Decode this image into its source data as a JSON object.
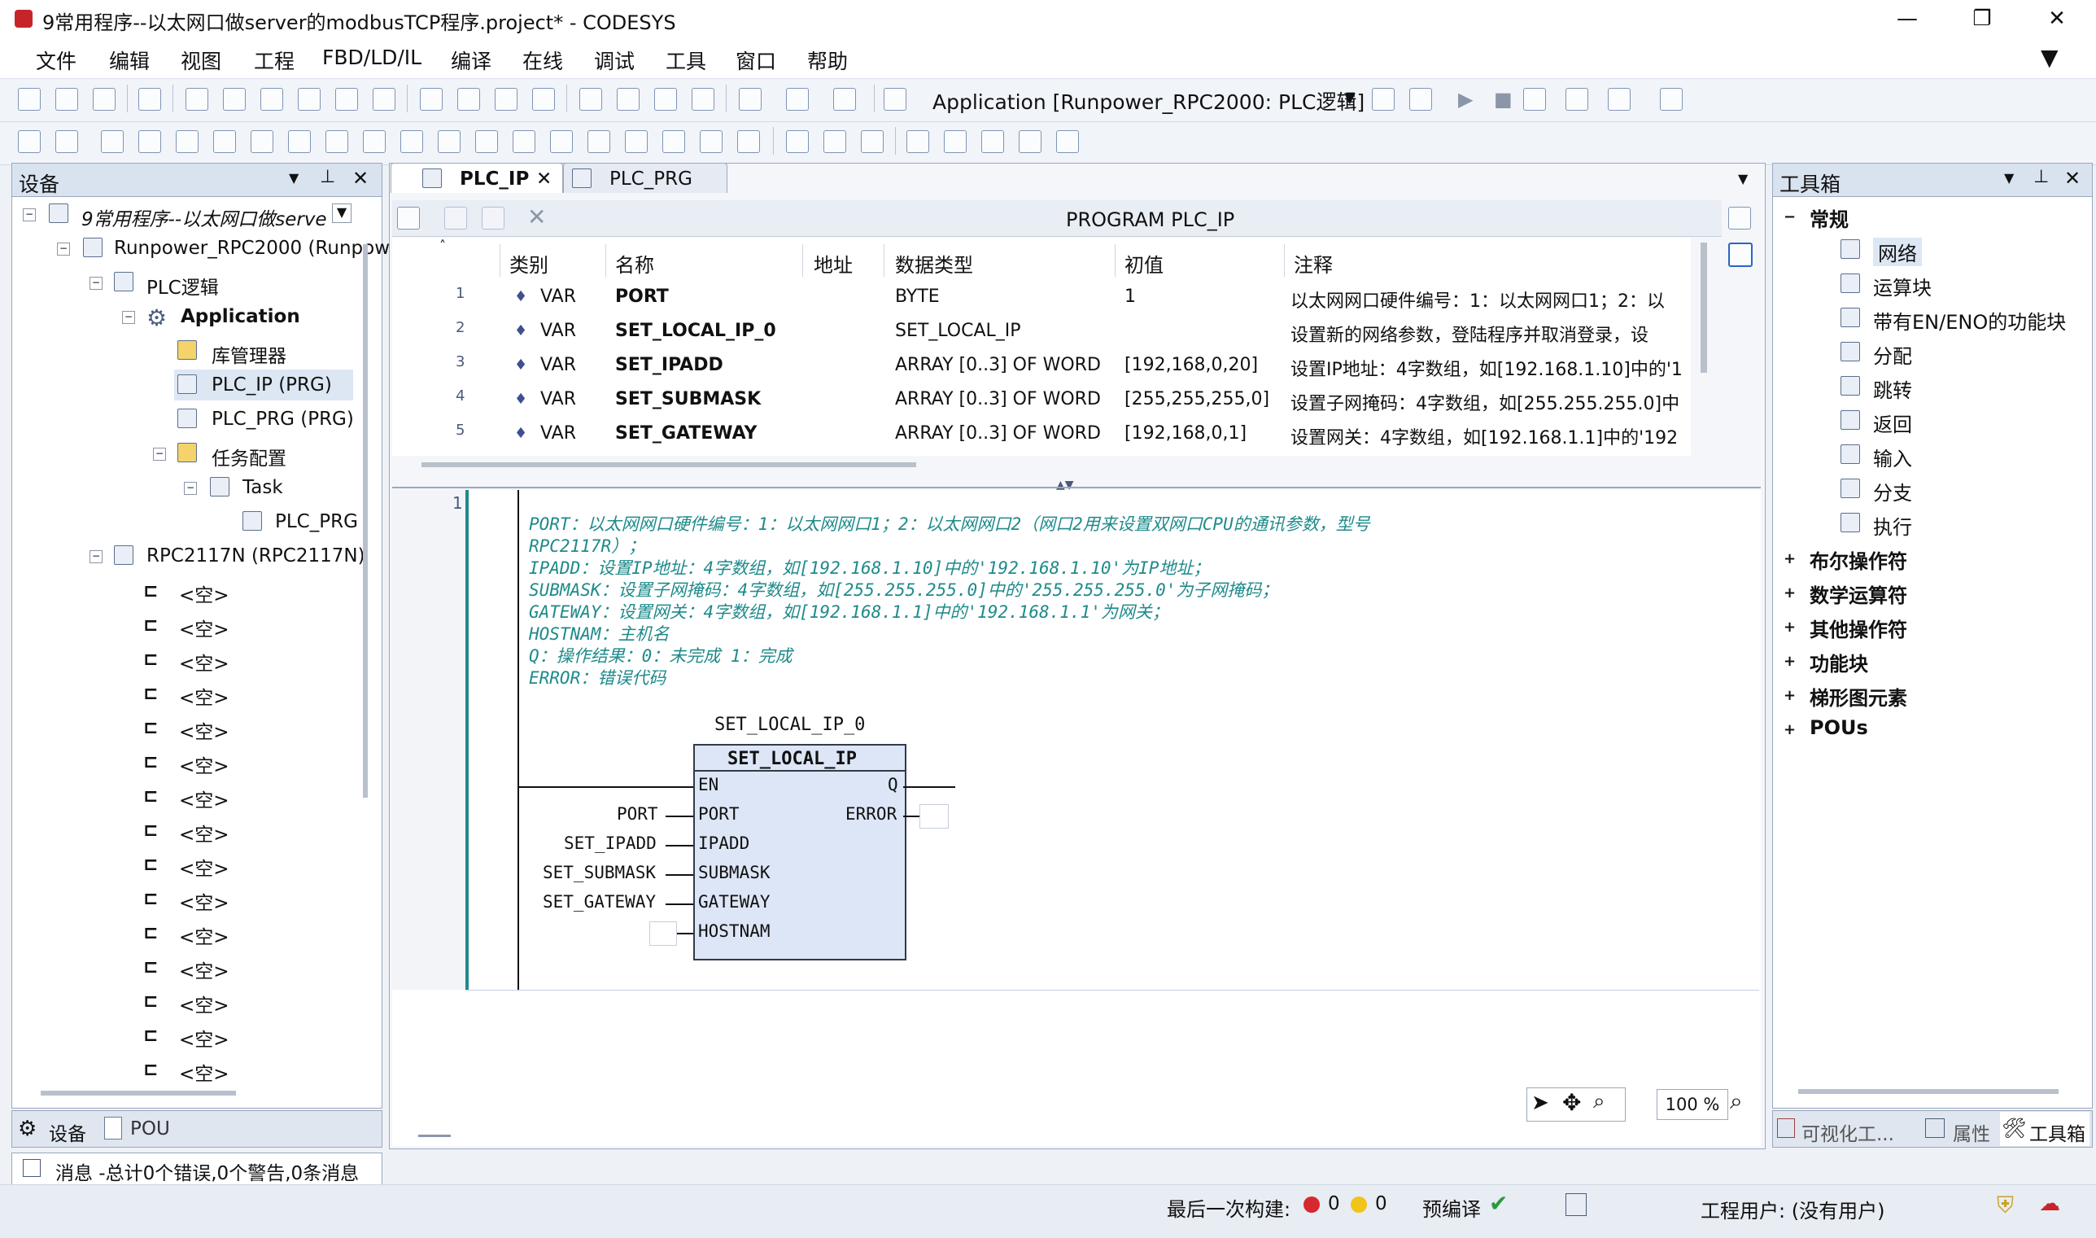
{
  "window": {
    "title": "9常用程序--以太网口做server的modbusTCP程序.project* - CODESYS",
    "minimize": "—",
    "maximize": "❐",
    "close": "✕"
  },
  "menu": [
    "文件",
    "编辑",
    "视图",
    "工程",
    "FBD/LD/IL",
    "编译",
    "在线",
    "调试",
    "工具",
    "窗口",
    "帮助"
  ],
  "toolbar": {
    "application_label": "Application [Runpower_RPC2000: PLC逻辑]"
  },
  "devices_panel": {
    "title": "设备",
    "tree": [
      {
        "label": "9常用程序--以太网口做serve",
        "icon": "project-icon"
      },
      {
        "label": "Runpower_RPC2000 (Runpow",
        "icon": "plc-icon"
      },
      {
        "label": "PLC逻辑",
        "icon": "logic-icon"
      },
      {
        "label": "Application",
        "icon": "gear-icon"
      },
      {
        "label": "库管理器",
        "icon": "library-icon"
      },
      {
        "label": "PLC_IP (PRG)",
        "icon": "pou-icon"
      },
      {
        "label": "PLC_PRG (PRG)",
        "icon": "pou-icon"
      },
      {
        "label": "任务配置",
        "icon": "task-config-icon"
      },
      {
        "label": "Task",
        "icon": "task-icon"
      },
      {
        "label": "PLC_PRG",
        "icon": "pou-call-icon"
      },
      {
        "label": "RPC2117N (RPC2117N)",
        "icon": "io-module-icon"
      }
    ],
    "empty_slots": [
      "<空>",
      "<空>",
      "<空>",
      "<空>",
      "<空>",
      "<空>",
      "<空>",
      "<空>",
      "<空>",
      "<空>",
      "<空>",
      "<空>",
      "<空>",
      "<空>",
      "<空>"
    ],
    "bottom_tabs": [
      "设备",
      "POU"
    ]
  },
  "editor": {
    "tabs": [
      "PLC_IP",
      "PLC_PRG"
    ],
    "header": "PROGRAM PLC_IP",
    "columns": [
      "类别",
      "名称",
      "地址",
      "数据类型",
      "初值",
      "注释"
    ],
    "rows": [
      {
        "num": "1",
        "cls": "VAR",
        "name": "PORT",
        "addr": "",
        "type": "BYTE",
        "init": "1",
        "comment": "以太网网口硬件编号：1：以太网网口1；2：以"
      },
      {
        "num": "2",
        "cls": "VAR",
        "name": "SET_LOCAL_IP_0",
        "addr": "",
        "type": "SET_LOCAL_IP",
        "init": "",
        "comment": "设置新的网络参数，登陆程序并取消登录，设"
      },
      {
        "num": "3",
        "cls": "VAR",
        "name": "SET_IPADD",
        "addr": "",
        "type": "ARRAY [0..3] OF WORD",
        "init": "[192,168,0,20]",
        "comment": "设置IP地址：4字数组，如[192.168.1.10]中的'1"
      },
      {
        "num": "4",
        "cls": "VAR",
        "name": "SET_SUBMASK",
        "addr": "",
        "type": "ARRAY [0..3] OF WORD",
        "init": "[255,255,255,0]",
        "comment": "设置子网掩码：4字数组，如[255.255.255.0]中"
      },
      {
        "num": "5",
        "cls": "VAR",
        "name": "SET_GATEWAY",
        "addr": "",
        "type": "ARRAY [0..3] OF WORD",
        "init": "[192,168,0,1]",
        "comment": "设置网关：4字数组，如[192.168.1.1]中的'192"
      }
    ],
    "network_number": "1",
    "network_comment": [
      "PORT：以太网网口硬件编号：1：以太网网口1；2：以太网网口2（网口2用来设置双网口CPU的通讯参数，型号",
      "RPC2117R）；",
      "IPADD：设置IP地址：4字数组，如[192.168.1.10]中的'192.168.1.10'为IP地址；",
      "SUBMASK：设置子网掩码：4字数组，如[255.255.255.0]中的'255.255.255.0'为子网掩码；",
      "GATEWAY：设置网关：4字数组，如[192.168.1.1]中的'192.168.1.1'为网关；",
      "HOSTNAM：主机名",
      "Q：操作结果：0：未完成 1：完成",
      "ERROR：错误代码"
    ],
    "fb": {
      "instance": "SET_LOCAL_IP_0",
      "type": "SET_LOCAL_IP",
      "inputs": [
        "EN",
        "PORT",
        "IPADD",
        "SUBMASK",
        "GATEWAY",
        "HOSTNAM"
      ],
      "outputs": [
        "Q",
        "ERROR"
      ],
      "input_vars": [
        "PORT",
        "SET_IPADD",
        "SET_SUBMASK",
        "SET_GATEWAY"
      ]
    },
    "zoom": "100 %"
  },
  "toolbox": {
    "title": "工具箱",
    "groups": [
      {
        "label": "常规",
        "expanded": true,
        "items": [
          "网络",
          "运算块",
          "带有EN/ENO的功能块",
          "分配",
          "跳转",
          "返回",
          "输入",
          "分支",
          "执行"
        ]
      },
      {
        "label": "布尔操作符"
      },
      {
        "label": "数学运算符"
      },
      {
        "label": "其他操作符"
      },
      {
        "label": "功能块"
      },
      {
        "label": "梯形图元素"
      },
      {
        "label": "POUs"
      }
    ],
    "bottom_tabs": [
      "可视化工...",
      "属性",
      "工具箱"
    ]
  },
  "messages": {
    "summary": "消息 -总计0个错误,0个警告,0条消息"
  },
  "status": {
    "last_build_label": "最后一次构建:",
    "errors": "0",
    "warnings": "0",
    "precompile_label": "预编译",
    "project_user": "工程用户: (没有用户)"
  },
  "colors": {
    "accent": "#1f8a8a",
    "panel_header": "#d9e3f0",
    "fb_fill": "#dde6f7"
  }
}
